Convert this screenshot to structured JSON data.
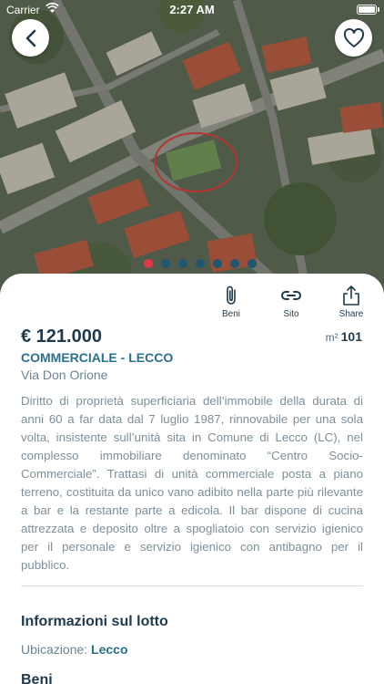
{
  "status_bar": {
    "carrier": "Carrier",
    "time": "2:27 AM"
  },
  "hero": {
    "image_subject": "aerial-photo",
    "slide_count": 7,
    "active_slide": 1
  },
  "colors": {
    "primary": "#1f3a4d",
    "accent_blue": "#2a7090",
    "active_dot": "#e03a4a",
    "dot": "#1f5670",
    "muted_text": "#7e8f99"
  },
  "actions": [
    {
      "label": "Beni",
      "icon": "paperclip-icon"
    },
    {
      "label": "Sito",
      "icon": "link-icon"
    },
    {
      "label": "Share",
      "icon": "share-icon"
    }
  ],
  "listing": {
    "price": "€ 121.000",
    "area_unit": "m²",
    "area_value": "101",
    "category": "COMMERCIALE - LECCO",
    "address": "Via Don Orione",
    "description": "Diritto di proprietà superficiaria dell’immobile della durata di anni 60 a far data dal 7 luglio 1987, rinnovabile per una sola volta, insistente sull’unità sita in Comune di Lecco (LC), nel complesso immobiliare denominato “Centro Socio-Commerciale”. Trattasi di unità commerciale posta a piano terreno, costituita da unico vano adibito nella parte più rilevante a bar e la restante parte a edicola. Il bar dispone di cucina attrezzata e deposito oltre a spogliatoio con servizio igienico per il personale e servizio igienico con antibagno per il pubblico."
  },
  "lotto": {
    "title": "Informazioni sul lotto",
    "location_label": "Ubicazione:",
    "location_value": "Lecco",
    "next_title": "Beni"
  }
}
